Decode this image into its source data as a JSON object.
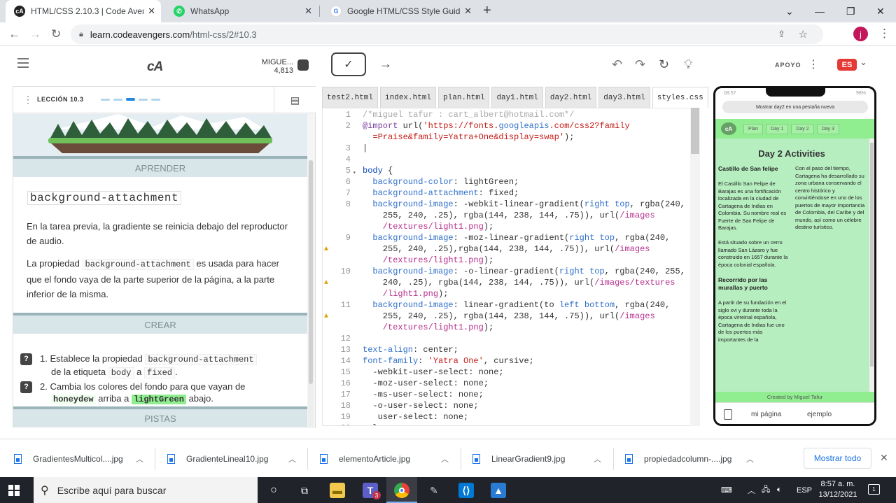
{
  "browser": {
    "tabs": [
      {
        "title": "HTML/CSS 2.10.3 | Code Avenge",
        "active": true
      },
      {
        "title": "WhatsApp",
        "active": false
      },
      {
        "title": "Google HTML/CSS Style Guide",
        "active": false
      }
    ],
    "url_host": "learn.codeavengers.com",
    "url_path": "/html-css/2#10.3",
    "profile_initial": "j"
  },
  "header": {
    "logo": "cA",
    "user_name": "MIGUE...",
    "user_points": "4,813",
    "support_label": "APOYO",
    "language": "ES"
  },
  "lesson": {
    "label": "LECCIÓN 10.3",
    "learn_title": "APRENDER",
    "property": "background-attachment",
    "para1": "En la tarea previa, la gradiente se reinicia debajo del reproductor de audio.",
    "para2_a": "La propiedad",
    "para2_code": "background-attachment",
    "para2_b": "es usada para hacer que el fondo vaya de la parte superior de la página, a la parte inferior de la misma.",
    "create_title": "CREAR",
    "task1_a": "1. Establece la propiedad",
    "task1_code": "background-attachment",
    "task1_b": "de la etiqueta",
    "task1_code2": "body",
    "task1_c": "a",
    "task1_code3": "fixed",
    "task1_d": ".",
    "task2_a": "2. Cambia los colores del fondo para que vayan de",
    "task2_code1": "honeydew",
    "task2_b": "arriba a",
    "task2_code2": "lightGreen",
    "task2_c": "abajo.",
    "hints_title": "PISTAS"
  },
  "editor": {
    "tabs": [
      "test2.html",
      "index.html",
      "plan.html",
      "day1.html",
      "day2.html",
      "day3.html",
      "styles.css"
    ],
    "active_tab": "styles.css"
  },
  "preview": {
    "time": "08:57",
    "battery": "98%",
    "open_btn": "Mostrar day2 en una pestaña nueva",
    "nav": [
      "Plan",
      "Day 1",
      "Day 2",
      "Day 3"
    ],
    "heading": "Day 2 Activities",
    "col1_h1": "Castillo de San felipe",
    "col1_p1": "El Castillo San Felipe de Barajas es una fortificación localizada en la ciudad de Cartagena de Indias en Colombia. Su nombre real es Fuerte de San Felipe de Barajas.",
    "col1_p2": "Está situado sobre un cerro llamado San Lázaro y fue construido en 1657 durante la época colonial española.",
    "col1_h2": "Recorrido por las murallas y puerto",
    "col1_p3": "A partir de su fundación en el siglo xvi y durante toda la época virreinal española, Cartagena de Indias fue uno de los puertos más importantes de la",
    "col2_p1": "Con el paso del tiempo, Cartagena ha desarrollado su zona urbana conservando el centro histórico y convirtiéndose en uno de los puertos de mayor importancia de Colombia, del Caribe y del mundo, así como un célebre destino turístico.",
    "footer": "Created by Miguel Tafur",
    "link1": "mi página",
    "link2": "ejemplo"
  },
  "downloads": {
    "files": [
      "GradientesMulticol....jpg",
      "GradienteLineal10.jpg",
      "elementoArticle.jpg",
      "LinearGradient9.jpg",
      "propiedadcolumn-....jpg"
    ],
    "show_all": "Mostrar todo"
  },
  "taskbar": {
    "search_placeholder": "Escribe aquí para buscar",
    "lang": "ESP",
    "time": "8:57 a. m.",
    "date": "13/12/2021",
    "teams_badge": "3"
  },
  "colors": {
    "accent_blue": "#1a73e8",
    "lesson_section": "#d9e6e9",
    "preview_green": "#90ee90",
    "lang_badge": "#e53935"
  }
}
